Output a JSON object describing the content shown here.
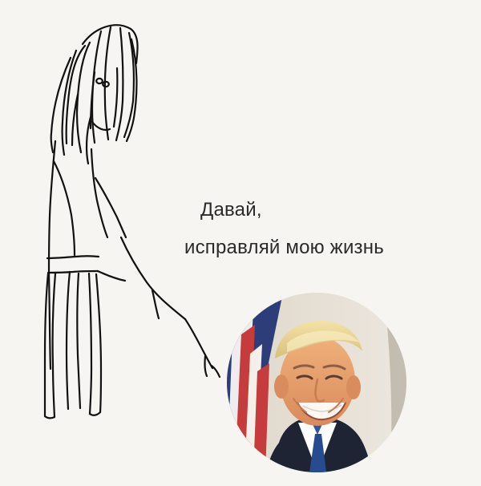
{
  "caption": {
    "line_1": "Давай,",
    "line_2": "исправляй мою жизнь"
  },
  "illustration": {
    "figure_icon": "stick-figure-drawing-icon",
    "portrait_icon": "round-portrait-photo-icon"
  },
  "colors": {
    "background": "#f6f5f1",
    "ink": "#111111",
    "text": "#2a2a2a"
  }
}
